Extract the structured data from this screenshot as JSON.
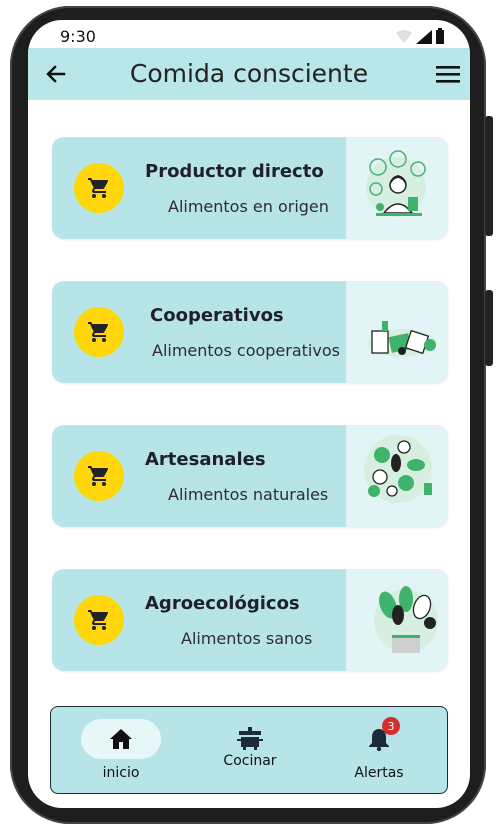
{
  "status_bar": {
    "time": "9:30"
  },
  "app_bar": {
    "title": "Comida consciente",
    "back_icon": "arrow-back-icon",
    "menu_icon": "hamburger-menu-icon"
  },
  "cards": [
    {
      "title": "Productor directo",
      "subtitle": "Alimentos en origen",
      "icon": "shopping-cart-icon",
      "illustration": "woman-with-vegetables-illustration"
    },
    {
      "title": "Cooperativos",
      "subtitle": "Alimentos cooperativos",
      "icon": "shopping-cart-icon",
      "illustration": "grocery-pile-illustration"
    },
    {
      "title": "Artesanales",
      "subtitle": "Alimentos naturales",
      "icon": "shopping-cart-icon",
      "illustration": "fruits-vegetables-illustration"
    },
    {
      "title": "Agroecológicos",
      "subtitle": "Alimentos sanos",
      "icon": "shopping-cart-icon",
      "illustration": "vegetable-basket-illustration"
    }
  ],
  "bottom_nav": {
    "items": [
      {
        "label": "inicio",
        "icon": "home-icon",
        "active": true
      },
      {
        "label": "Cocinar",
        "icon": "cooking-pot-icon",
        "active": false
      },
      {
        "label": "Alertas",
        "icon": "bell-icon",
        "badge": "3",
        "active": false
      }
    ]
  },
  "colors": {
    "app_bar": "#b9e6e8",
    "card": "#b7e4e6",
    "cart_badge": "#ffd60a",
    "alert_badge": "#d32f2f"
  }
}
